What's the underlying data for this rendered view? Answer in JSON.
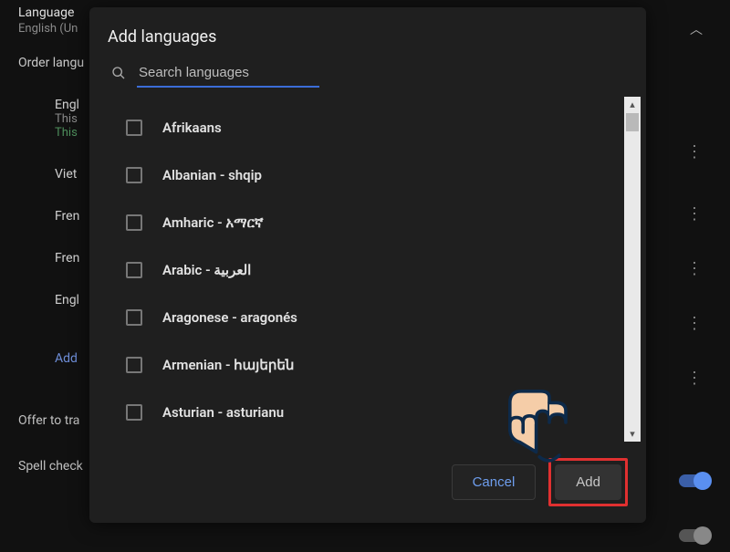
{
  "background": {
    "language_label": "Language",
    "language_value": "English (Un",
    "order_section": "Order langu",
    "items": [
      "Engl",
      "Viet",
      "Fren",
      "Fren",
      "Engl"
    ],
    "item1_sub": "This",
    "item1_green": "This",
    "add_link": "Add",
    "offer": "Offer to tra",
    "spell": "Spell check"
  },
  "dialog": {
    "title": "Add languages",
    "search_placeholder": "Search languages",
    "languages": [
      "Afrikaans",
      "Albanian - shqip",
      "Amharic - አማርኛ",
      "Arabic - العربية",
      "Aragonese - aragonés",
      "Armenian - հայերեն",
      "Asturian - asturianu"
    ],
    "cancel": "Cancel",
    "add": "Add"
  }
}
